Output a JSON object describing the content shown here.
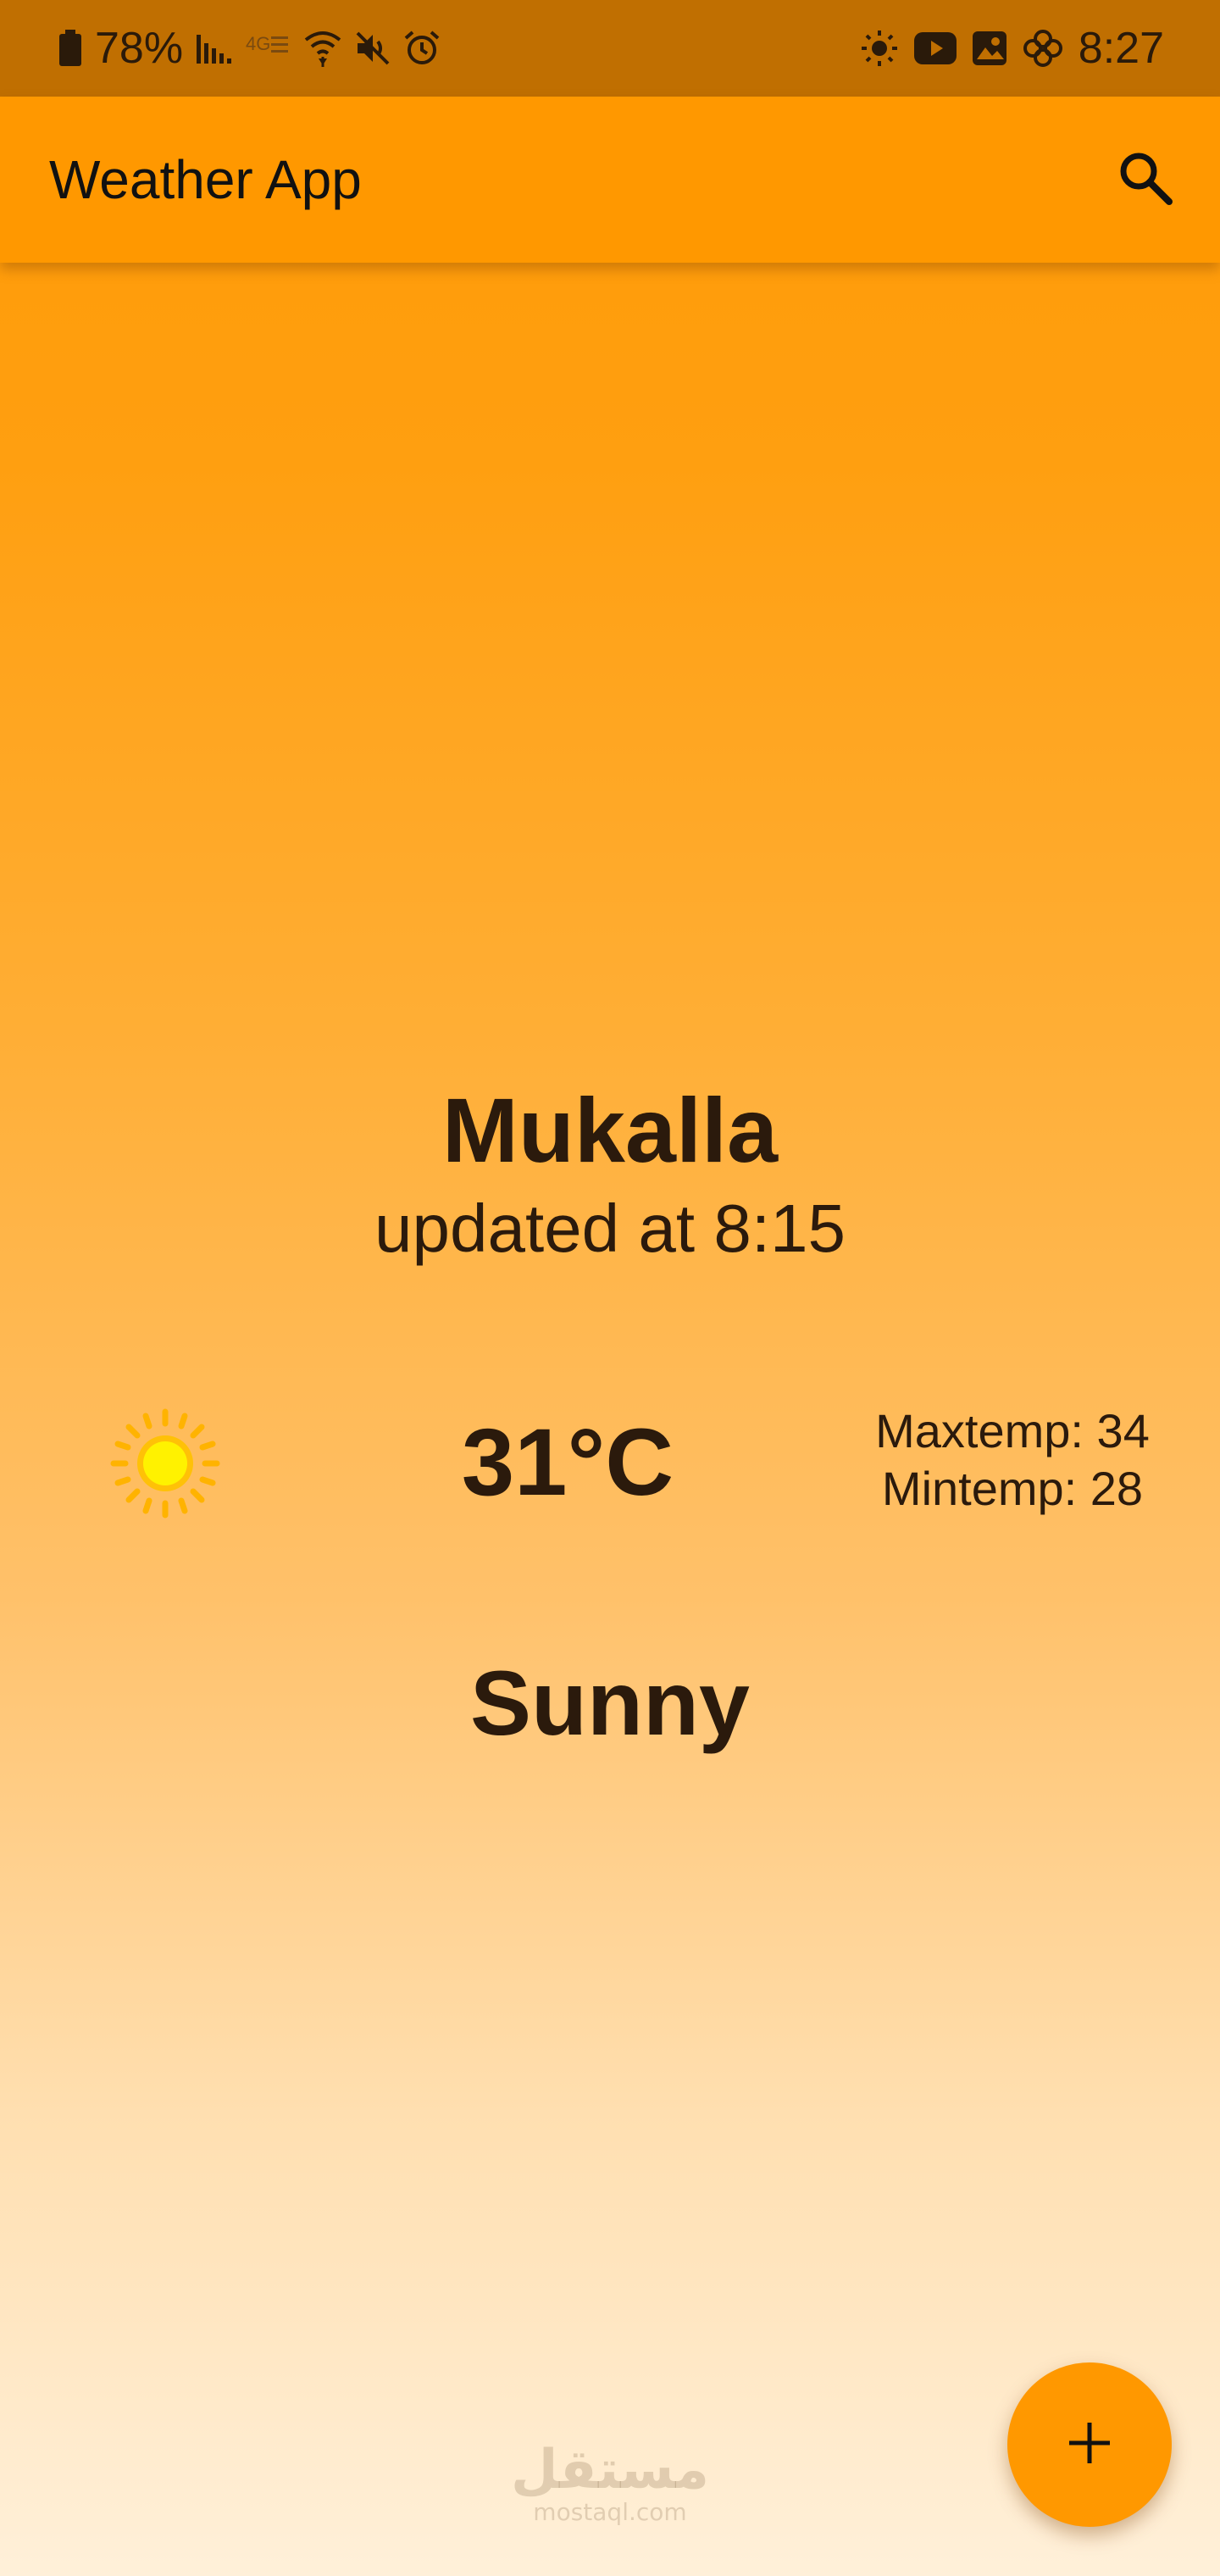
{
  "status_bar": {
    "battery_percent": "78%",
    "time": "8:27",
    "left_icons": [
      "battery-icon",
      "signal-bars-icon",
      "4g-icon",
      "wifi-icon",
      "mute-icon",
      "alarm-icon"
    ],
    "right_icons": [
      "brightness-icon",
      "youtube-icon",
      "gallery-icon",
      "settings-flower-icon"
    ]
  },
  "app_bar": {
    "title": "Weather App",
    "search_icon": "search-icon"
  },
  "weather": {
    "city": "Mukalla",
    "updated": "updated at 8:15",
    "temperature": "31°C",
    "max_temp": "Maxtemp: 34",
    "min_temp": "Mintemp: 28",
    "condition": "Sunny",
    "condition_icon": "sun-icon"
  },
  "watermark": {
    "arabic": "مستقل",
    "latin": "mostaql.com"
  },
  "fab": {
    "icon": "plus-icon"
  },
  "colors": {
    "status_bar": "#c06f01",
    "app_bar": "#ff9800",
    "fab": "#ff9800",
    "gradient_top": "#ff9a05",
    "gradient_bottom": "#fff0d9",
    "text": "#2b1a0c"
  }
}
